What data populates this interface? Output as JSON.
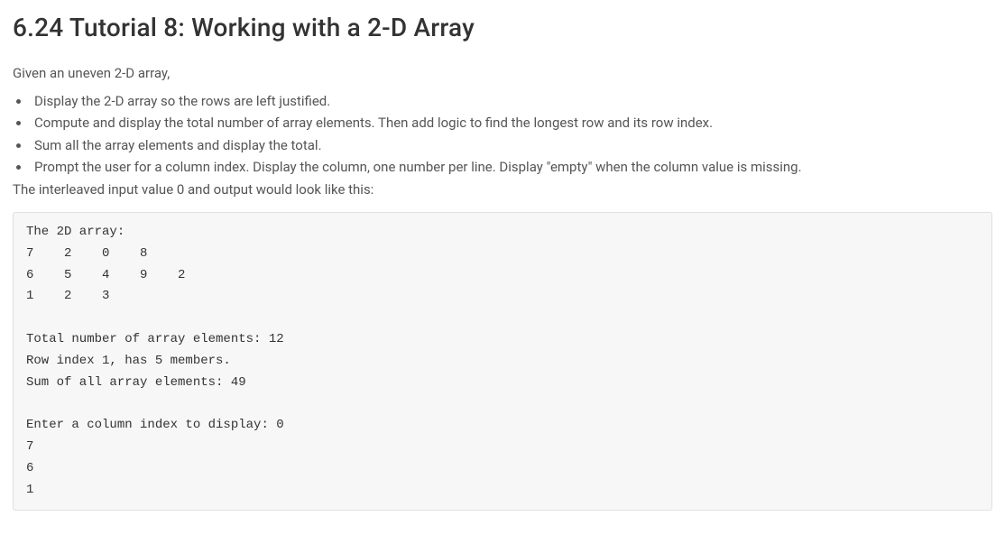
{
  "title": "6.24 Tutorial 8: Working with a 2-D Array",
  "intro": "Given an uneven 2-D array,",
  "bullets": [
    "Display the 2-D array so the rows are left justified.",
    "Compute and display the total number of array elements. Then add logic to find the longest row and its row index.",
    "Sum all the array elements and display the total.",
    "Prompt the user for a column index. Display the column, one number per line. Display \"empty\" when the column value is missing."
  ],
  "after_list": "The interleaved input value 0 and output would look like this:",
  "output": "The 2D array:\n7    2    0    8\n6    5    4    9    2\n1    2    3\n\nTotal number of array elements: 12\nRow index 1, has 5 members.\nSum of all array elements: 49\n\nEnter a column index to display: 0\n7\n6\n1"
}
